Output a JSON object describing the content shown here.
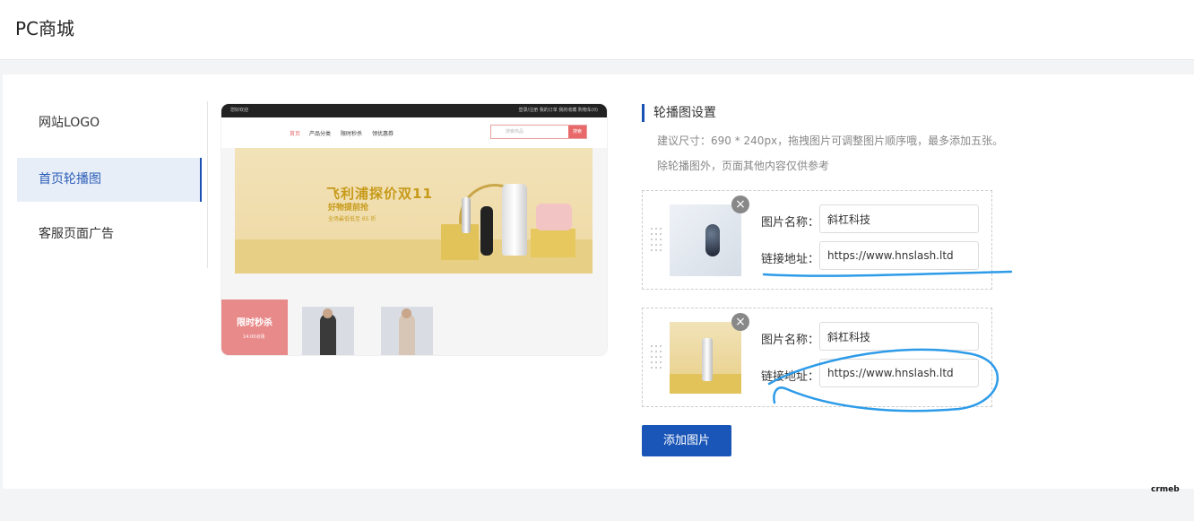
{
  "header": {
    "title": "PC商城"
  },
  "menu": {
    "items": [
      {
        "label": "网站LOGO",
        "active": false
      },
      {
        "label": "首页轮播图",
        "active": true
      },
      {
        "label": "客服页面广告",
        "active": false
      }
    ]
  },
  "preview": {
    "top_left": "您好欢迎",
    "top_right": "登录/注册   我的订单   我的收藏      购物车(0)",
    "nav": [
      "首页",
      "产品分类",
      "限时秒杀",
      "领优惠券"
    ],
    "search_placeholder": "搜索商品",
    "search_button": "搜索",
    "banner": {
      "headline": "飞利浦探价双11",
      "sub": "好物提前抢",
      "note": "全场最低低至 65 折"
    },
    "flash": {
      "title": "限时秒杀",
      "time": "14:00点场"
    }
  },
  "settings": {
    "title": "轮播图设置",
    "hint1": "建议尺寸：690 * 240px，拖拽图片可调整图片顺序哦，最多添加五张。",
    "hint2": "除轮播图外，页面其他内容仅供参考",
    "name_label": "图片名称：",
    "link_label": "链接地址：",
    "items": [
      {
        "name": "斜杠科技",
        "link": "https://www.hnslash.ltd"
      },
      {
        "name": "斜杠科技",
        "link": "https://www.hnslash.ltd"
      }
    ],
    "add_button": "添加图片"
  },
  "colors": {
    "accent": "#1a56b8",
    "annotation": "#2d9be8",
    "preview_red": "#e86969"
  },
  "brand": "crmeb"
}
